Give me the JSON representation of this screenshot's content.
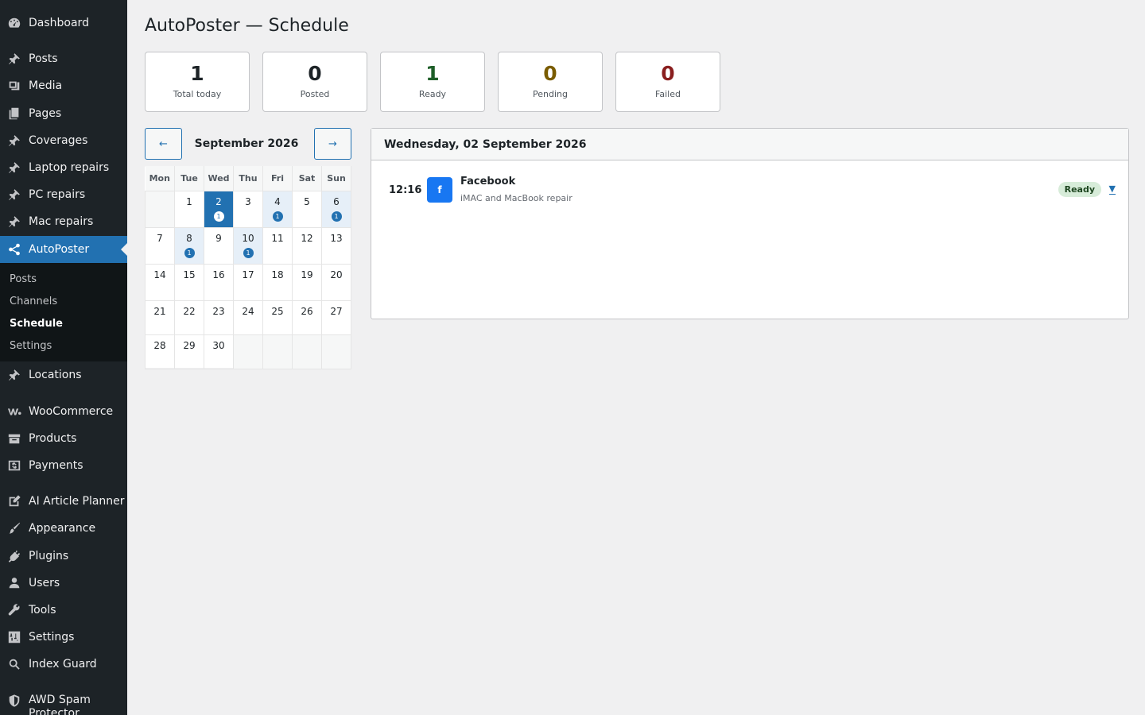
{
  "sidebar": {
    "items": [
      {
        "label": "Dashboard",
        "icon": "dashboard-icon"
      },
      {
        "label": "Posts",
        "icon": "pin-icon"
      },
      {
        "label": "Media",
        "icon": "media-icon"
      },
      {
        "label": "Pages",
        "icon": "pages-icon"
      },
      {
        "label": "Coverages",
        "icon": "pin-icon"
      },
      {
        "label": "Laptop repairs",
        "icon": "pin-icon"
      },
      {
        "label": "PC repairs",
        "icon": "pin-icon"
      },
      {
        "label": "Mac repairs",
        "icon": "pin-icon"
      },
      {
        "label": "AutoPoster",
        "icon": "share-icon"
      },
      {
        "label": "Locations",
        "icon": "pin-icon"
      },
      {
        "label": "WooCommerce",
        "icon": "woocommerce-icon"
      },
      {
        "label": "Products",
        "icon": "archive-icon"
      },
      {
        "label": "Payments",
        "icon": "dollar-icon"
      },
      {
        "label": "AI Article Planner",
        "icon": "edit-icon"
      },
      {
        "label": "Appearance",
        "icon": "brush-icon"
      },
      {
        "label": "Plugins",
        "icon": "plugin-icon"
      },
      {
        "label": "Users",
        "icon": "user-icon"
      },
      {
        "label": "Tools",
        "icon": "wrench-icon"
      },
      {
        "label": "Settings",
        "icon": "sliders-icon"
      },
      {
        "label": "Index Guard",
        "icon": "search-icon"
      },
      {
        "label": "AWD Spam Protector",
        "icon": "shield-icon"
      }
    ],
    "submenu": [
      {
        "label": "Posts"
      },
      {
        "label": "Channels"
      },
      {
        "label": "Schedule"
      },
      {
        "label": "Settings"
      }
    ]
  },
  "page": {
    "title": "AutoPoster — Schedule"
  },
  "stats": [
    {
      "value": "1",
      "label": "Total today",
      "color": "#1d2327"
    },
    {
      "value": "0",
      "label": "Posted",
      "color": "#1d2327"
    },
    {
      "value": "1",
      "label": "Ready",
      "color": "#1e5e28"
    },
    {
      "value": "0",
      "label": "Pending",
      "color": "#7a5c00"
    },
    {
      "value": "0",
      "label": "Failed",
      "color": "#8a1f1f"
    }
  ],
  "calendar": {
    "prev_label": "←",
    "next_label": "→",
    "month_label": "September 2026",
    "weekdays": [
      "Mon",
      "Tue",
      "Wed",
      "Thu",
      "Fri",
      "Sat",
      "Sun"
    ],
    "days": [
      "1",
      "2",
      "3",
      "4",
      "5",
      "6",
      "7",
      "8",
      "9",
      "10",
      "11",
      "12",
      "13",
      "14",
      "15",
      "16",
      "17",
      "18",
      "19",
      "20",
      "21",
      "22",
      "23",
      "24",
      "25",
      "26",
      "27",
      "28",
      "29",
      "30"
    ],
    "counts": {
      "2": "1",
      "4": "1",
      "6": "1",
      "8": "1",
      "10": "1"
    },
    "selected_day": "2"
  },
  "day_panel": {
    "title": "Wednesday, 02 September 2026",
    "entries": [
      {
        "time": "12:16",
        "channel_icon_letter": "f",
        "channel": "Facebook",
        "title": "iMAC and MacBook repair",
        "status": "Ready",
        "toggle": "▼"
      }
    ]
  },
  "colors": {
    "admin_bar": "#1d2327",
    "accent": "#2271b1",
    "facebook": "#1877f2",
    "status_ready_bg": "#d7ecd9"
  }
}
